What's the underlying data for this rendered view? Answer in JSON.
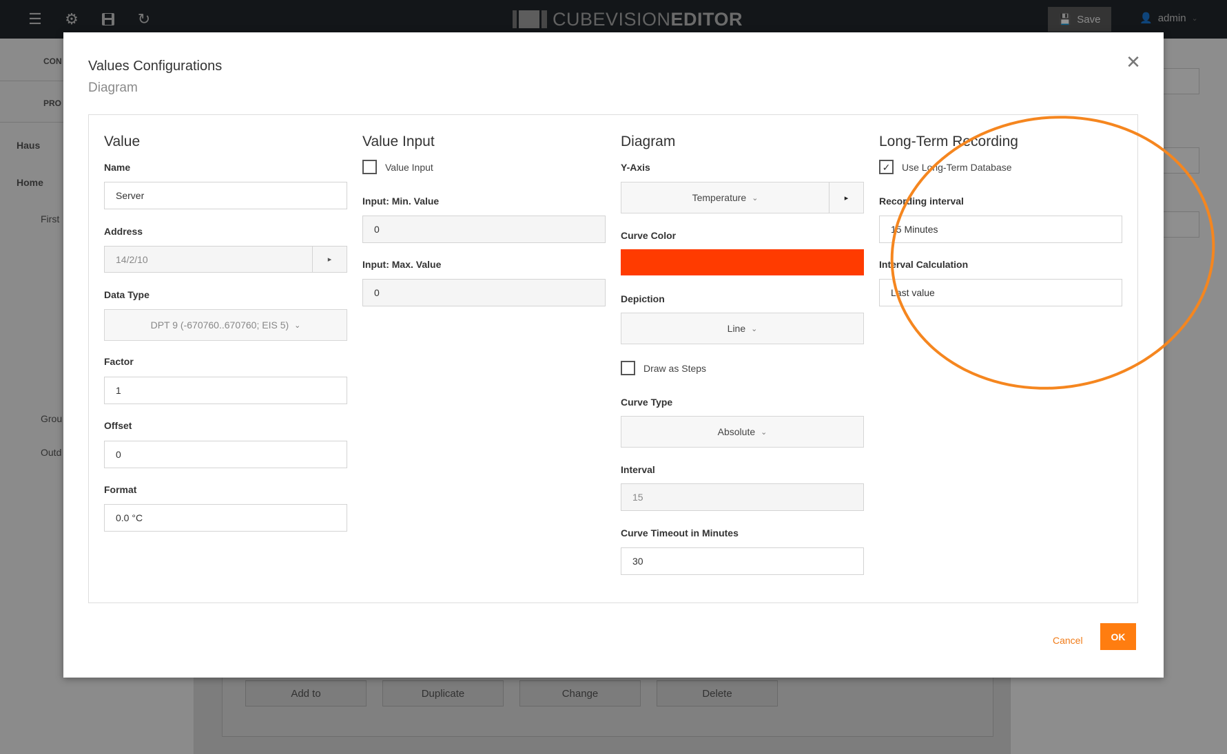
{
  "topbar": {
    "brand_light": "CUBEVISION",
    "brand_bold": "EDITOR",
    "save_label": "Save",
    "user_label": "admin"
  },
  "background": {
    "sidebar_items": [
      {
        "label": "CON"
      },
      {
        "label": "PRO"
      },
      {
        "label": "Haus"
      },
      {
        "label": "Home"
      },
      {
        "label": "First"
      },
      {
        "label": "Grou"
      },
      {
        "label": "Outd"
      }
    ],
    "action_buttons": [
      "Add to",
      "Duplicate",
      "Change",
      "Delete"
    ]
  },
  "modal": {
    "title": "Values Configurations",
    "subtitle": "Diagram",
    "cancel_label": "Cancel",
    "ok_label": "OK",
    "value": {
      "title": "Value",
      "name_label": "Name",
      "name_value": "Server",
      "address_label": "Address",
      "address_value": "14/2/10",
      "datatype_label": "Data Type",
      "datatype_value": "DPT 9 (-670760..670760; EIS 5)",
      "factor_label": "Factor",
      "factor_value": "1",
      "offset_label": "Offset",
      "offset_value": "0",
      "format_label": "Format",
      "format_value": "0.0 °C"
    },
    "value_input": {
      "title": "Value Input",
      "checkbox_label": "Value Input",
      "checked": false,
      "min_label": "Input: Min. Value",
      "min_value": "0",
      "max_label": "Input: Max. Value",
      "max_value": "0"
    },
    "diagram": {
      "title": "Diagram",
      "yaxis_label": "Y-Axis",
      "yaxis_value": "Temperature",
      "curve_color_label": "Curve Color",
      "curve_color": "#ff3b00",
      "depiction_label": "Depiction",
      "depiction_value": "Line",
      "steps_label": "Draw as Steps",
      "steps_checked": false,
      "curve_type_label": "Curve Type",
      "curve_type_value": "Absolute",
      "interval_label": "Interval",
      "interval_value": "15",
      "timeout_label": "Curve Timeout in Minutes",
      "timeout_value": "30"
    },
    "long_term": {
      "title": "Long-Term Recording",
      "checkbox_label": "Use Long-Term Database",
      "checked": true,
      "recording_label": "Recording interval",
      "recording_value": "15 Minutes",
      "calc_label": "Interval Calculation",
      "calc_value": "Last value"
    }
  },
  "colors": {
    "accent": "#ff7d10",
    "highlight_ring": "#f5861f"
  }
}
